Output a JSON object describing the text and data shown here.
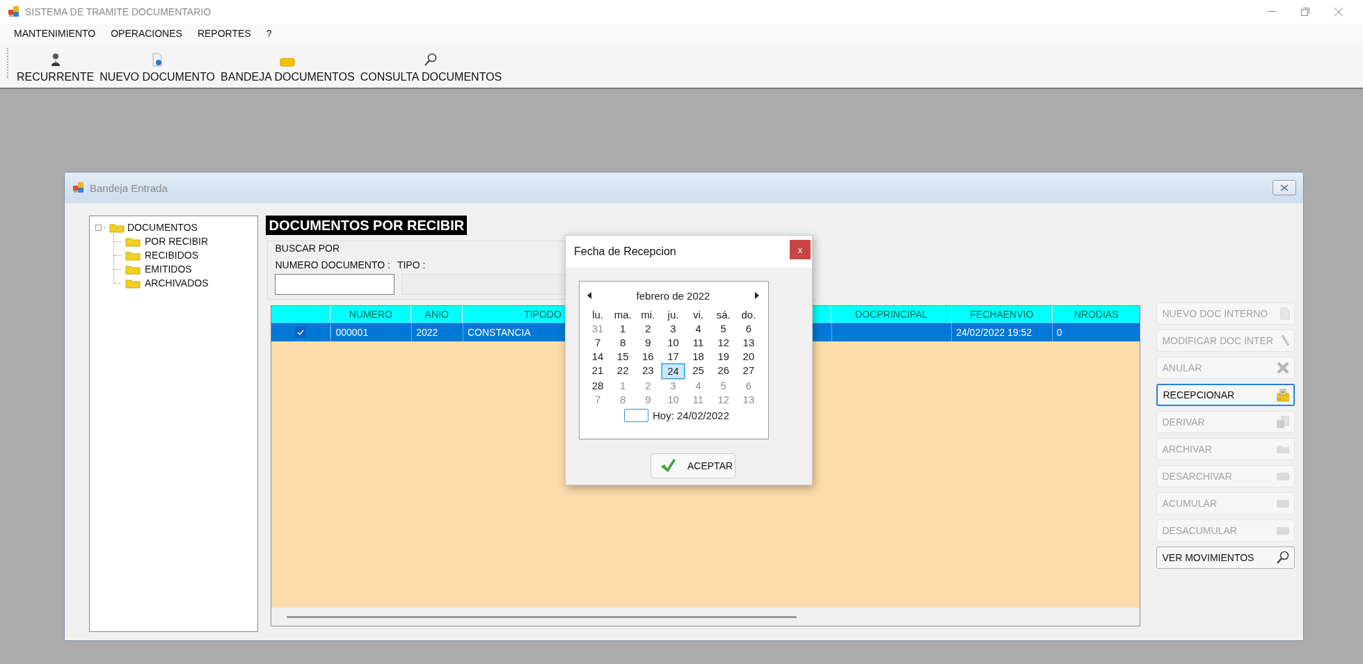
{
  "window": {
    "title": "SISTEMA DE TRAMITE DOCUMENTARIO"
  },
  "menu": [
    {
      "label": "MANTENIMIENTO"
    },
    {
      "label": "OPERACIONES"
    },
    {
      "label": "REPORTES"
    },
    {
      "label": "?"
    }
  ],
  "toolbar": [
    {
      "label": "RECURRENTE"
    },
    {
      "label": "NUEVO DOCUMENTO"
    },
    {
      "label": "BANDEJA DOCUMENTOS"
    },
    {
      "label": "CONSULTA DOCUMENTOS"
    }
  ],
  "child_window": {
    "title": "Bandeja Entrada",
    "tree": {
      "label": "DOCUMENTOS",
      "expanded": true,
      "selected": false,
      "children": [
        {
          "label": "POR RECIBIR",
          "selected": false
        },
        {
          "label": "RECIBIDOS",
          "selected": false
        },
        {
          "label": "EMITIDOS",
          "selected": false
        },
        {
          "label": "ARCHIVADOS",
          "selected": false
        }
      ]
    },
    "heading": "DOCUMENTOS POR RECIBIR",
    "search": {
      "title": "BUSCAR POR",
      "number_label": "NUMERO DOCUMENTO :",
      "type_label": "TIPO :",
      "type_disabled": true
    },
    "grid": {
      "columns": [
        "NUMERO",
        "ANIO",
        "TIPODO",
        "DOCPRINCIPAL",
        "FECHAENVIO",
        "NRODIAS"
      ],
      "rows": [
        {
          "selected": true,
          "checked": true,
          "cells": [
            "000001",
            "2022",
            "CONSTANCIA",
            null,
            "24/02/2022 19:52",
            "0"
          ]
        }
      ]
    },
    "buttons": [
      {
        "label": "NUEVO DOC INTERNO",
        "disabled": true,
        "focused": false
      },
      {
        "label": "MODIFICAR DOC INTER",
        "disabled": true,
        "focused": false
      },
      {
        "label": "ANULAR",
        "disabled": true,
        "focused": false
      },
      {
        "label": "RECEPCIONAR",
        "disabled": false,
        "focused": true
      },
      {
        "label": "DERIVAR",
        "disabled": true,
        "focused": false
      },
      {
        "label": "ARCHIVAR",
        "disabled": true,
        "focused": false
      },
      {
        "label": "DESARCHIVAR",
        "disabled": true,
        "focused": false
      },
      {
        "label": "ACUMULAR",
        "disabled": true,
        "focused": false
      },
      {
        "label": "DESACUMULAR",
        "disabled": true,
        "focused": false
      },
      {
        "label": "VER MOVIMIENTOS",
        "disabled": false,
        "focused": false
      }
    ]
  },
  "dialog": {
    "title": "Fecha de Recepcion",
    "close": "x",
    "calendar": {
      "month": "febrero de 2022",
      "weekdays": [
        "lu.",
        "ma.",
        "mi.",
        "ju.",
        "vi.",
        "sá.",
        "do."
      ],
      "weeks": [
        [
          {
            "day": "31",
            "other": true,
            "selected": false
          },
          {
            "day": "1",
            "other": false,
            "selected": false
          },
          {
            "day": "2",
            "other": false,
            "selected": false
          },
          {
            "day": "3",
            "other": false,
            "selected": false
          },
          {
            "day": "4",
            "other": false,
            "selected": false
          },
          {
            "day": "5",
            "other": false,
            "selected": false
          },
          {
            "day": "6",
            "other": false,
            "selected": false
          }
        ],
        [
          {
            "day": "7",
            "other": false,
            "selected": false
          },
          {
            "day": "8",
            "other": false,
            "selected": false
          },
          {
            "day": "9",
            "other": false,
            "selected": false
          },
          {
            "day": "10",
            "other": false,
            "selected": false
          },
          {
            "day": "11",
            "other": false,
            "selected": false
          },
          {
            "day": "12",
            "other": false,
            "selected": false
          },
          {
            "day": "13",
            "other": false,
            "selected": false
          }
        ],
        [
          {
            "day": "14",
            "other": false,
            "selected": false
          },
          {
            "day": "15",
            "other": false,
            "selected": false
          },
          {
            "day": "16",
            "other": false,
            "selected": false
          },
          {
            "day": "17",
            "other": false,
            "selected": false
          },
          {
            "day": "18",
            "other": false,
            "selected": false
          },
          {
            "day": "19",
            "other": false,
            "selected": false
          },
          {
            "day": "20",
            "other": false,
            "selected": false
          }
        ],
        [
          {
            "day": "21",
            "other": false,
            "selected": false
          },
          {
            "day": "22",
            "other": false,
            "selected": false
          },
          {
            "day": "23",
            "other": false,
            "selected": false
          },
          {
            "day": "24",
            "other": false,
            "selected": true
          },
          {
            "day": "25",
            "other": false,
            "selected": false
          },
          {
            "day": "26",
            "other": false,
            "selected": false
          },
          {
            "day": "27",
            "other": false,
            "selected": false
          }
        ],
        [
          {
            "day": "28",
            "other": false,
            "selected": false
          },
          {
            "day": "1",
            "other": true,
            "selected": false
          },
          {
            "day": "2",
            "other": true,
            "selected": false
          },
          {
            "day": "3",
            "other": true,
            "selected": false
          },
          {
            "day": "4",
            "other": true,
            "selected": false
          },
          {
            "day": "5",
            "other": true,
            "selected": false
          },
          {
            "day": "6",
            "other": true,
            "selected": false
          }
        ],
        [
          {
            "day": "7",
            "other": true,
            "selected": false
          },
          {
            "day": "8",
            "other": true,
            "selected": false
          },
          {
            "day": "9",
            "other": true,
            "selected": false
          },
          {
            "day": "10",
            "other": true,
            "selected": false
          },
          {
            "day": "11",
            "other": true,
            "selected": false
          },
          {
            "day": "12",
            "other": true,
            "selected": false
          },
          {
            "day": "13",
            "other": true,
            "selected": false
          }
        ]
      ],
      "today": "Hoy: 24/02/2022"
    },
    "ok": "ACEPTAR"
  }
}
